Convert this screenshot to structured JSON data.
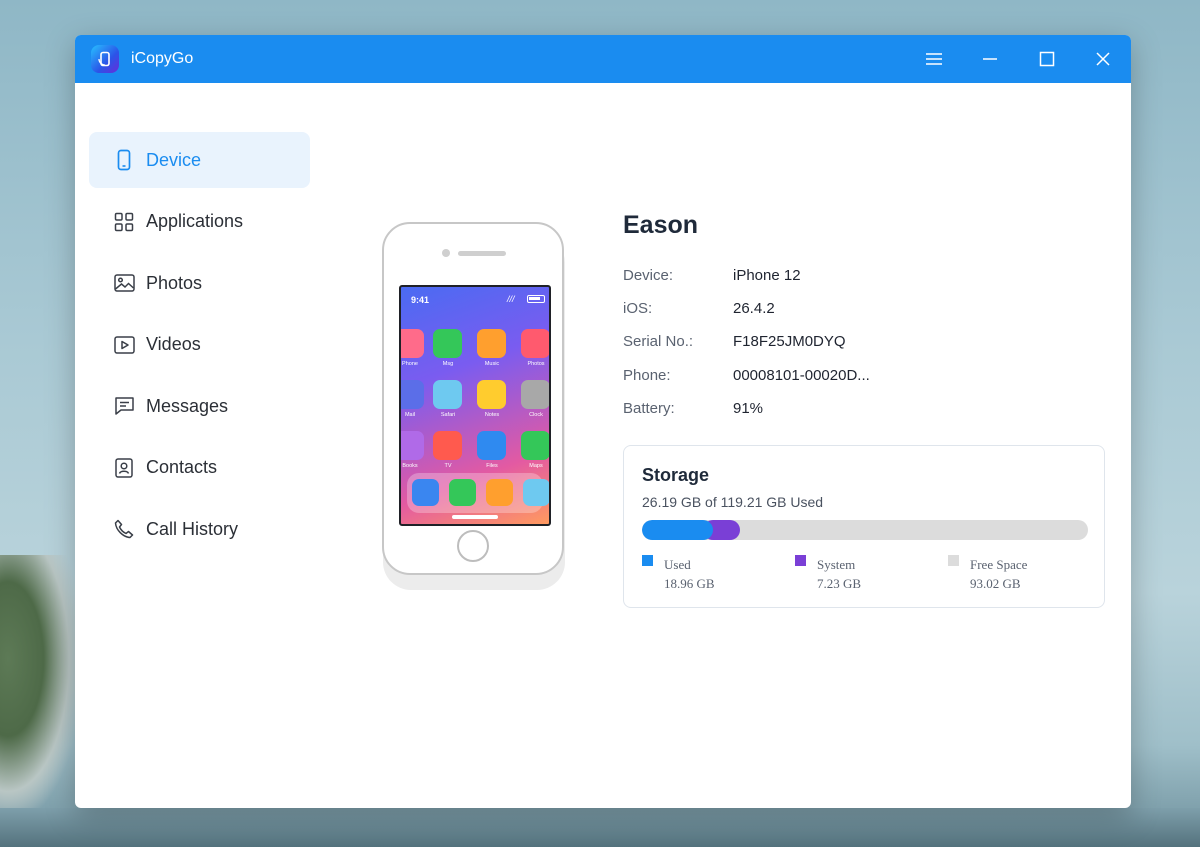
{
  "app": {
    "title": "iCopyGo"
  },
  "window_controls": [
    "menu-icon",
    "minimize-icon",
    "maximize-icon",
    "close-icon"
  ],
  "sidebar": {
    "items": [
      {
        "label": "Device",
        "icon": "phone-icon",
        "active": true
      },
      {
        "label": "Applications",
        "icon": "grid-icon",
        "active": false
      },
      {
        "label": "Photos",
        "icon": "image-icon",
        "active": false
      },
      {
        "label": "Videos",
        "icon": "play-icon",
        "active": false
      },
      {
        "label": "Messages",
        "icon": "message-icon",
        "active": false
      },
      {
        "label": "Contacts",
        "icon": "contact-icon",
        "active": false
      },
      {
        "label": "Call History",
        "icon": "phone-call-icon",
        "active": false
      }
    ]
  },
  "phone_screen": {
    "time": "9:41",
    "apps": [
      {
        "label": "Phone",
        "color": "#ff6b8a"
      },
      {
        "label": "Msg",
        "color": "#34c759"
      },
      {
        "label": "Music",
        "color": "#ff9f2e"
      },
      {
        "label": "Photos",
        "color": "#ff5a6e"
      },
      {
        "label": "Mail",
        "color": "#5b6ee8"
      },
      {
        "label": "Safari",
        "color": "#6ec9f0"
      },
      {
        "label": "Notes",
        "color": "#ffcc2e"
      },
      {
        "label": "Clock",
        "color": "#a8a8a8"
      },
      {
        "label": "Books",
        "color": "#b06ae8"
      },
      {
        "label": "TV",
        "color": "#ff5a4e"
      },
      {
        "label": "Files",
        "color": "#2f8af0"
      },
      {
        "label": "Maps",
        "color": "#34c759"
      }
    ],
    "dock": [
      "#3a86f0",
      "#34c759",
      "#ff9f2e",
      "#6ec9f0"
    ]
  },
  "device": {
    "name": "Eason",
    "fields": [
      {
        "label": "Device:",
        "value": "iPhone 12"
      },
      {
        "label": "iOS:",
        "value": "26.4.2"
      },
      {
        "label": "Serial No.:",
        "value": "F18F25JM0DYQ"
      },
      {
        "label": "Phone:",
        "value": "00008101-00020D..."
      },
      {
        "label": "Battery:",
        "value": "91%"
      }
    ]
  },
  "storage": {
    "title": "Storage",
    "summary": "26.19 GB of 119.21 GB Used",
    "total_gb": 119.21,
    "used_gb": 18.96,
    "system_gb": 7.23,
    "legend": [
      {
        "name": "Used",
        "value": "18.96 GB",
        "color": "#1a8cf0"
      },
      {
        "name": "System",
        "value": "7.23 GB",
        "color": "#7a3fd6"
      },
      {
        "name": "Free Space",
        "value": "93.02 GB",
        "color": "#dcdcdc"
      }
    ]
  }
}
